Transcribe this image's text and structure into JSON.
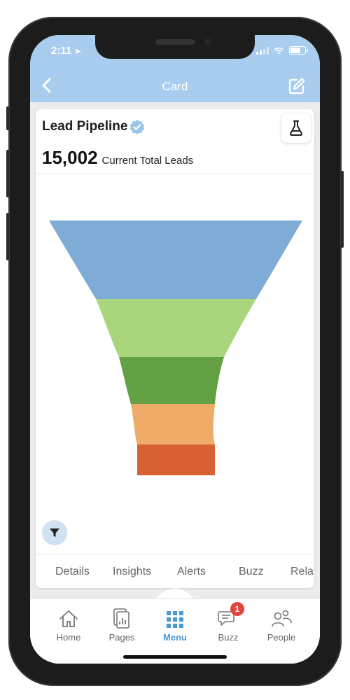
{
  "status": {
    "time": "2:11",
    "location_arrow": "➤"
  },
  "header": {
    "title": "Card",
    "back_icon": "chevron-left-icon",
    "edit_icon": "edit-icon",
    "color": "#a8cdee"
  },
  "card": {
    "title": "Lead Pipeline",
    "verified_icon": "verified-badge-icon",
    "lab_icon": "flask-icon",
    "metric_value": "15,002",
    "metric_label": "Current Total Leads",
    "filter_icon": "filter-icon"
  },
  "funnel": {
    "stages": [
      {
        "color": "#7eacd6"
      },
      {
        "color": "#a9d67c"
      },
      {
        "color": "#64a044"
      },
      {
        "color": "#eeac68"
      },
      {
        "color": "#d76131"
      }
    ]
  },
  "tabs": [
    "Details",
    "Insights",
    "Alerts",
    "Buzz",
    "Relat"
  ],
  "bottom_nav": [
    {
      "label": "Home",
      "icon": "home-icon",
      "active": false
    },
    {
      "label": "Pages",
      "icon": "pages-icon",
      "active": false
    },
    {
      "label": "Menu",
      "icon": "grid-icon",
      "active": true
    },
    {
      "label": "Buzz",
      "icon": "chat-icon",
      "active": false,
      "badge": "1"
    },
    {
      "label": "People",
      "icon": "people-icon",
      "active": false
    }
  ],
  "colors": {
    "accent": "#4a9ad7",
    "badge": "#e2453c"
  }
}
